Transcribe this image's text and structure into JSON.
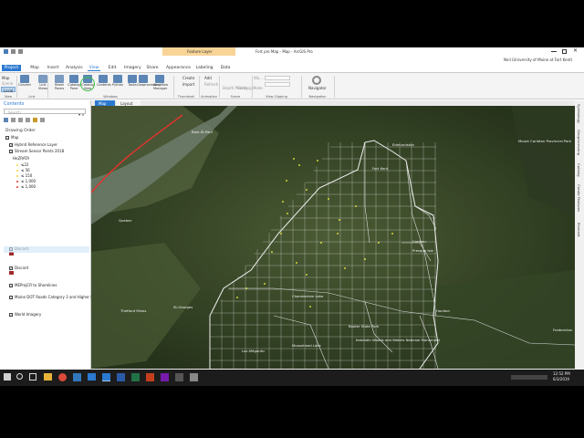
{
  "window": {
    "title": "Fort pro Map - Map - ArcGIS Pro",
    "context_group": "Feature Layer",
    "user": "Neil (University of Maine at Fort Kent)"
  },
  "ribbon_tabs": [
    "Project",
    "Map",
    "Insert",
    "Analysis",
    "View",
    "Edit",
    "Imagery",
    "Share",
    "Appearance",
    "Labeling",
    "Data"
  ],
  "ribbon": {
    "buttons": [
      {
        "label": "Convert",
        "name": "convert"
      },
      {
        "label": "Link Views",
        "name": "link-views"
      },
      {
        "label": "Reset Panes",
        "name": "reset-panes"
      },
      {
        "label": "Catalog Pane",
        "name": "catalog-pane"
      },
      {
        "label": "Catalog View",
        "name": "catalog-view"
      },
      {
        "label": "Contents",
        "name": "contents"
      },
      {
        "label": "Python",
        "name": "python"
      },
      {
        "label": "Tasks",
        "name": "tasks"
      },
      {
        "label": "Geoprocessing",
        "name": "geoprocessing"
      },
      {
        "label": "Workflow Manager",
        "name": "workflow-manager"
      }
    ],
    "small": {
      "create": "Create",
      "import": "Import",
      "add": "Add",
      "refresh": "Refresh",
      "depth": "Depth Priority",
      "viewing": "Viewing Mode",
      "clip_state": "Wa...",
      "navigator": "Navigator"
    },
    "groups": [
      "View",
      "Link",
      "Windows",
      "Thumbnail",
      "Animation",
      "Scene",
      "View Clipping",
      "Navigation"
    ],
    "view_options": [
      "Map",
      "Scene",
      "Local"
    ]
  },
  "contents": {
    "title": "Contents",
    "search_placeholder": "Search",
    "drawing_order": "Drawing Order",
    "items": [
      {
        "label": "Map",
        "checked": true
      },
      {
        "label": "Hybrid Reference Layer",
        "checked": true
      },
      {
        "label": "Stream Sensor Points 2018",
        "checked": true
      },
      {
        "label": "HeZRATA",
        "checked": false
      },
      {
        "label": "≤22",
        "checked": false
      },
      {
        "label": "≤ 56",
        "checked": false
      },
      {
        "label": "≤ 150",
        "checked": false
      },
      {
        "label": "≤ 1,000",
        "checked": false
      },
      {
        "label": "≤ 1,000",
        "checked": false
      },
      {
        "label": "Discard",
        "checked": true
      },
      {
        "label": "Discard",
        "checked": true
      },
      {
        "label": "MEProjCR to Shorelines",
        "checked": true
      },
      {
        "label": "Maine DOT Roads Category 3 and Higher Lines",
        "checked": true
      },
      {
        "label": "World Imagery",
        "checked": true
      }
    ]
  },
  "map_tabs": [
    "Map",
    "Layout"
  ],
  "map_labels": [
    {
      "text": "Baie-St-Paul"
    },
    {
      "text": "Edmundston"
    },
    {
      "text": "Mount Carleton Provincial Park"
    },
    {
      "text": "Quebec"
    },
    {
      "text": "Fort Kent"
    },
    {
      "text": "Caribou"
    },
    {
      "text": "Presque Isle"
    },
    {
      "text": "Houlton"
    },
    {
      "text": "Chamberlain Lake"
    },
    {
      "text": "Baxter State Park"
    },
    {
      "text": "Katahdin Woods and Waters National Monument"
    },
    {
      "text": "Moosehead Lake"
    },
    {
      "text": "St-Georges"
    },
    {
      "text": "Fredericton"
    },
    {
      "text": "Thetford Mines"
    },
    {
      "text": "Lac-Mégantic"
    }
  ],
  "right_panel": [
    "Symbology",
    "Geoprocessing",
    "Catalog",
    "Create Features",
    "Element"
  ],
  "status": {
    "scale": "1:802,346",
    "coords": "71.3387100°W 46.7653486°N",
    "selected": "Selected Features: 0"
  },
  "taskbar": {
    "time": "12:52 PM",
    "date": "6/3/2019"
  },
  "colors": {
    "accent": "#2b79d0",
    "project_tab": "#2b79d0",
    "feature_layer": "#f3b040",
    "grid": "#e6e6e6",
    "points": "#ffff3c",
    "annotation": "#e0342c"
  }
}
